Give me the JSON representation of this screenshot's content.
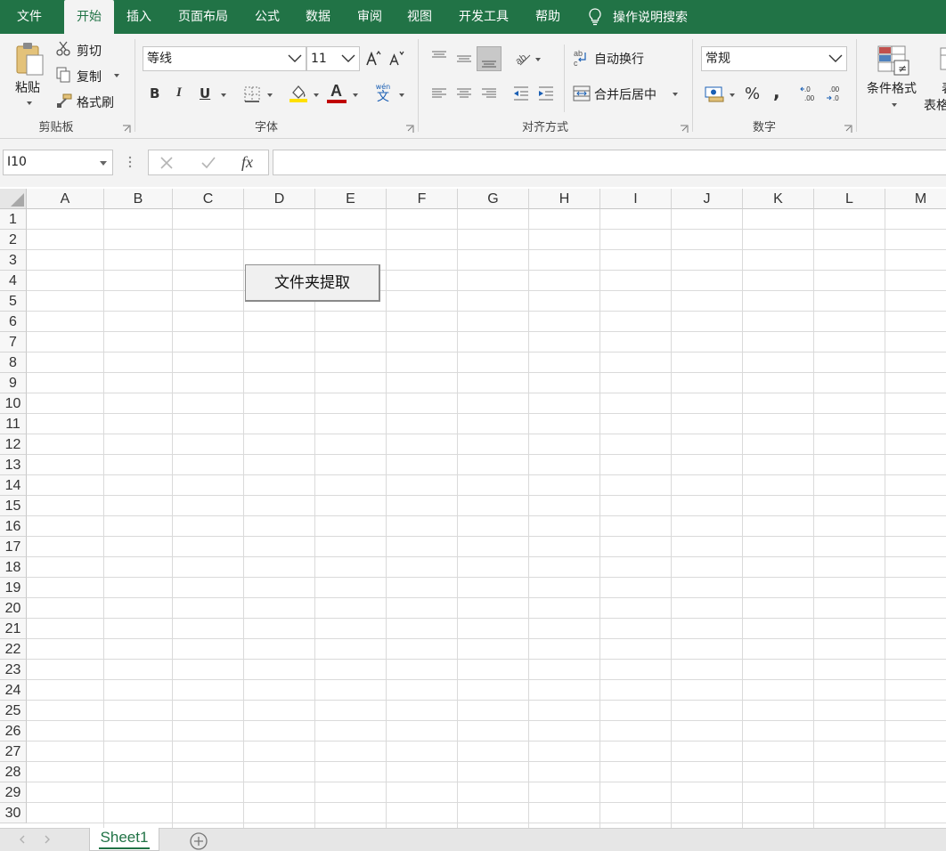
{
  "tabs": [
    {
      "label": "文件",
      "active": false
    },
    {
      "label": "开始",
      "active": true
    },
    {
      "label": "插入",
      "active": false
    },
    {
      "label": "页面布局",
      "active": false
    },
    {
      "label": "公式",
      "active": false
    },
    {
      "label": "数据",
      "active": false
    },
    {
      "label": "审阅",
      "active": false
    },
    {
      "label": "视图",
      "active": false
    },
    {
      "label": "开发工具",
      "active": false
    },
    {
      "label": "帮助",
      "active": false
    }
  ],
  "tell_me": {
    "label": "操作说明搜索",
    "icon": "lightbulb-icon"
  },
  "ribbon": {
    "clipboard": {
      "group_label": "剪贴板",
      "paste_label": "粘贴",
      "cut_label": "剪切",
      "copy_label": "复制",
      "format_painter_label": "格式刷"
    },
    "font": {
      "group_label": "字体",
      "font_name": "等线",
      "font_size": "11",
      "bold": "B",
      "italic": "I",
      "underline": "U",
      "font_color_letter": "A",
      "phonetic_top": "wén",
      "phonetic_char": "文"
    },
    "alignment": {
      "group_label": "对齐方式",
      "wrap_text_label": "自动换行",
      "merge_center_label": "合并后居中"
    },
    "number": {
      "group_label": "数字",
      "format": "常规",
      "percent": "%",
      "comma": ","
    },
    "styles": {
      "conditional_format_label": "条件格式",
      "format_table_partial": "表"
    }
  },
  "formula_bar": {
    "name_box": "I10",
    "fx_label": "fx",
    "formula": ""
  },
  "grid": {
    "columns": [
      "A",
      "B",
      "C",
      "D",
      "E",
      "F",
      "G",
      "H",
      "I",
      "J",
      "K",
      "L",
      "M"
    ],
    "rows": [
      "1",
      "2",
      "3",
      "4",
      "5",
      "6",
      "7",
      "8",
      "9",
      "10",
      "11",
      "12",
      "13",
      "14",
      "15",
      "16",
      "17",
      "18",
      "19",
      "20",
      "21",
      "22",
      "23",
      "24",
      "25",
      "26",
      "27",
      "28",
      "29",
      "30"
    ]
  },
  "macro_button": {
    "label": "文件夹提取"
  },
  "sheets": [
    {
      "name": "Sheet1",
      "active": true
    }
  ],
  "colors": {
    "accent": "#217346",
    "highlight_yellow": "#ffe000",
    "font_red": "#c00000"
  }
}
